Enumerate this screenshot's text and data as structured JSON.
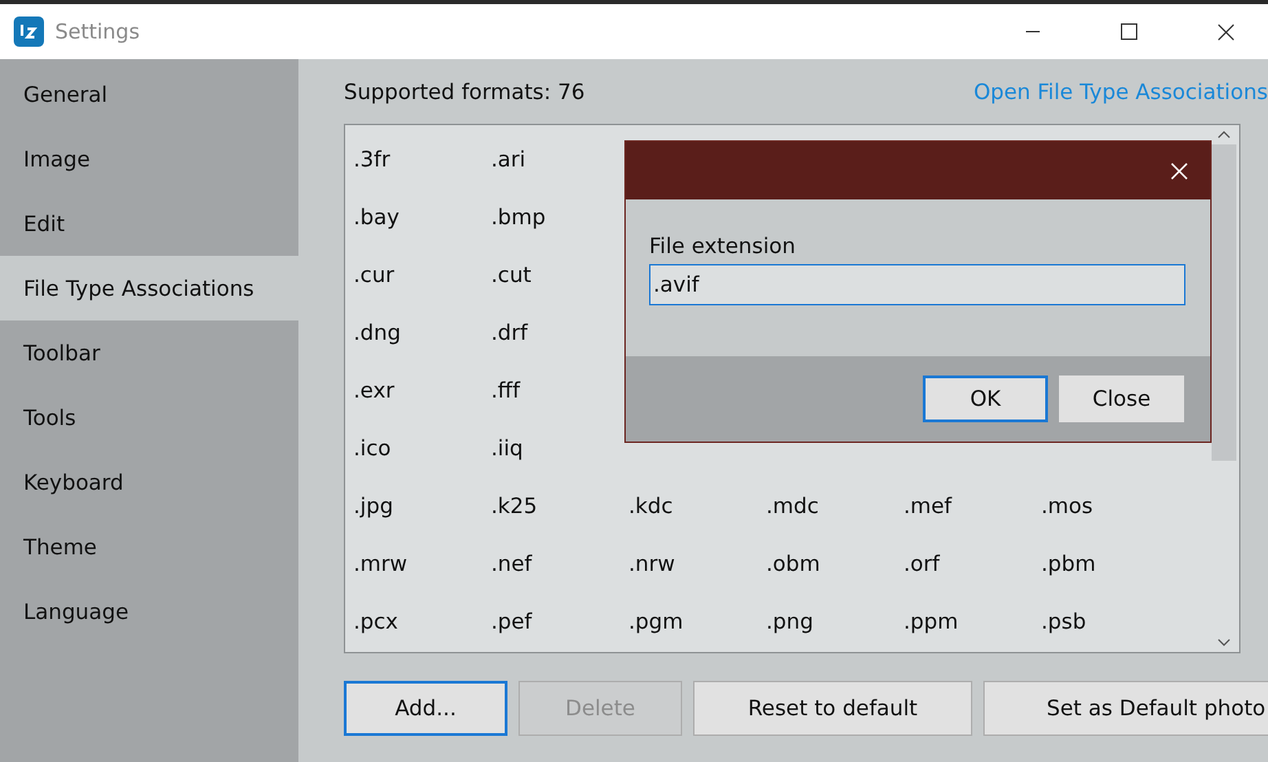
{
  "window": {
    "title": "Settings"
  },
  "sidebar": {
    "items": [
      {
        "label": "General",
        "selected": false
      },
      {
        "label": "Image",
        "selected": false
      },
      {
        "label": "Edit",
        "selected": false
      },
      {
        "label": "File Type Associations",
        "selected": true
      },
      {
        "label": "Toolbar",
        "selected": false
      },
      {
        "label": "Tools",
        "selected": false
      },
      {
        "label": "Keyboard",
        "selected": false
      },
      {
        "label": "Theme",
        "selected": false
      },
      {
        "label": "Language",
        "selected": false
      }
    ]
  },
  "header": {
    "count_label": "Supported formats: 76",
    "link": "Open File Type Associations"
  },
  "format_rows": [
    [
      ".3fr",
      ".ari"
    ],
    [
      ".bay",
      ".bmp"
    ],
    [
      ".cur",
      ".cut"
    ],
    [
      ".dng",
      ".drf"
    ],
    [
      ".exr",
      ".fff"
    ],
    [
      ".ico",
      ".iiq"
    ],
    [
      ".jpg",
      ".k25",
      ".kdc",
      ".mdc",
      ".mef",
      ".mos"
    ],
    [
      ".mrw",
      ".nef",
      ".nrw",
      ".obm",
      ".orf",
      ".pbm"
    ],
    [
      ".pcx",
      ".pef",
      ".pgm",
      ".png",
      ".ppm",
      ".psb"
    ]
  ],
  "buttons": [
    {
      "label": "Add...",
      "disabled": false,
      "focused": true
    },
    {
      "label": "Delete",
      "disabled": true,
      "focused": false
    },
    {
      "label": "Reset to default",
      "disabled": false,
      "focused": false
    },
    {
      "label": "Set as Default photo",
      "disabled": false,
      "focused": false
    }
  ],
  "dialog": {
    "field_label": "File extension",
    "value": ".avif",
    "buttons": [
      {
        "label": "OK",
        "focused": true
      },
      {
        "label": "Close",
        "focused": false
      }
    ]
  }
}
